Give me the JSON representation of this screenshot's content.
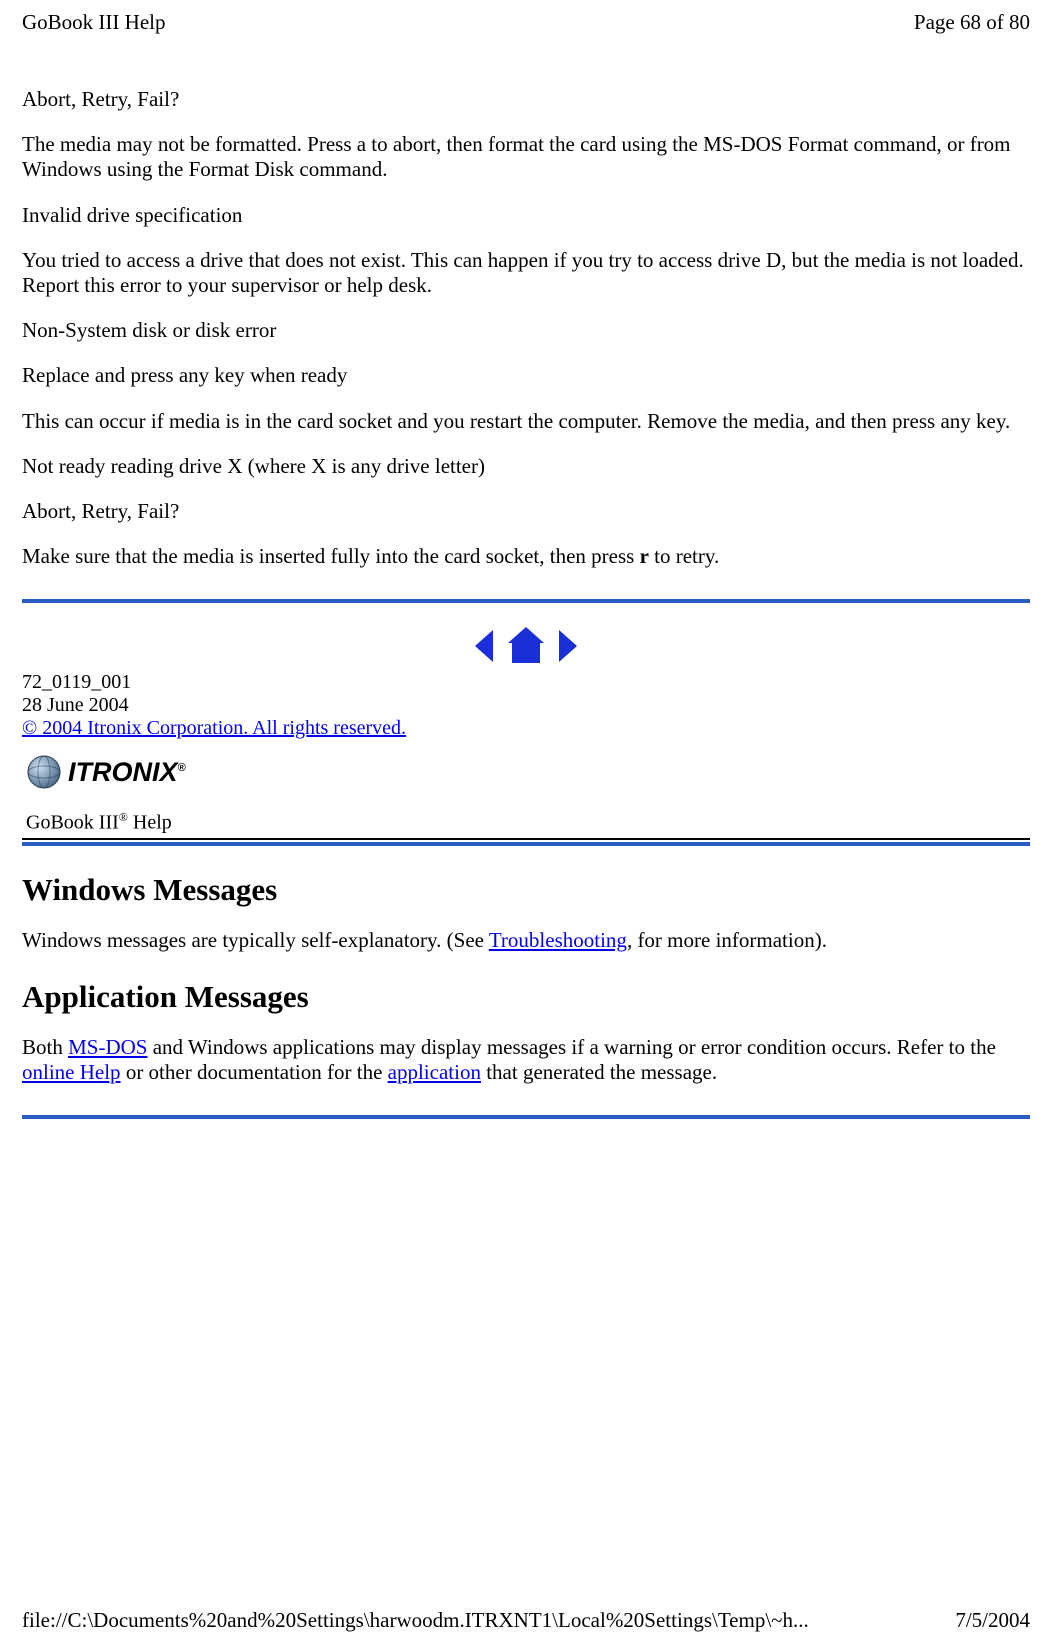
{
  "header": {
    "title": "GoBook III Help",
    "page_indicator": "Page 68 of 80"
  },
  "content": {
    "p1": "Abort, Retry, Fail?",
    "p2": "The media may not be formatted. Press a to abort, then format the card using the MS-DOS Format command, or from Windows using the Format Disk command.",
    "p3": "Invalid drive specification",
    "p4": "You tried to access a drive that does not exist. This can happen if you try to access drive D, but the media is not loaded. Report this error to your supervisor or help desk.",
    "p5": "Non-System disk or disk error",
    "p6": "Replace and press any key when ready",
    "p7": "This can occur if media is in the card socket and you restart the computer. Remove the media, and then press any key.",
    "p8": "Not ready reading drive X (where X is any drive letter)",
    "p9": "Abort, Retry, Fail?",
    "p10_before": "Make sure that the media is inserted fully into the card socket, then press ",
    "p10_bold": "r",
    "p10_after": " to retry."
  },
  "docinfo": {
    "doc_number": "72_0119_001",
    "doc_date": "28 June 2004",
    "copyright": "© 2004 Itronix Corporation.  All rights reserved."
  },
  "logo": {
    "brand": "ITRONIX",
    "helpline_prefix": "GoBook III",
    "helpline_sup": "®",
    "helpline_suffix": " Help"
  },
  "sections": {
    "h1": "Windows Messages",
    "s1_before": "Windows messages are typically self-explanatory. (See ",
    "s1_link": "Troubleshooting",
    "s1_after": ", for more information).",
    "h2": "Application Messages",
    "s2_before": "Both ",
    "s2_link1": "MS-DOS",
    "s2_mid1": " and Windows applications may display messages if a warning or error condition occurs. Refer to the ",
    "s2_link2": "online Help",
    "s2_mid2": " or other documentation for the ",
    "s2_link3": "application",
    "s2_after": " that generated the message."
  },
  "footer": {
    "path": "file://C:\\Documents%20and%20Settings\\harwoodm.ITRXNT1\\Local%20Settings\\Temp\\~h...",
    "date": "7/5/2004"
  }
}
